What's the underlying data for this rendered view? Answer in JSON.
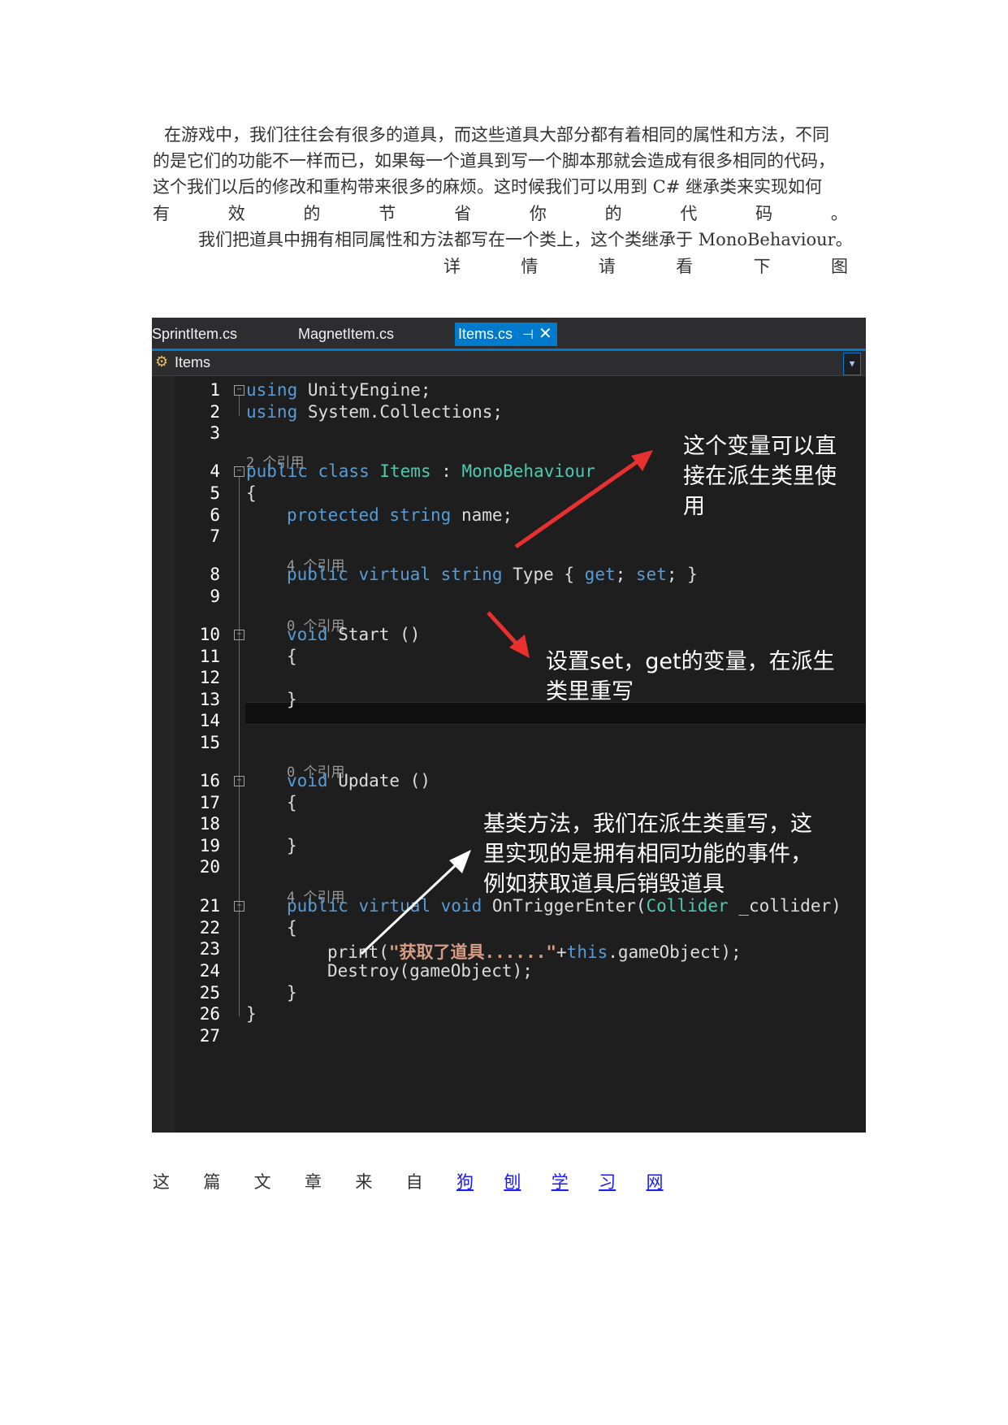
{
  "intro": {
    "line1": "在游戏中，我们往往会有很多的道具，而这些道具大部分都有着相同的属性和方法，不同",
    "line2": "的是它们的功能不一样而已，如果每一个道具到写一个脚本那就会造成有很多相同的代码，",
    "line3": "这个我们以后的修改和重构带来很多的麻烦。这时候我们可以用到 C#  继承类来实现如何",
    "line4": [
      "有",
      "效",
      "的",
      "节",
      "省",
      "你",
      "的",
      "代",
      "码",
      "。"
    ],
    "line5": "我们把道具中拥有相同属性和方法都写在一个类上，这个类继承于 MonoBehaviour。",
    "line6": [
      "详",
      "情",
      "请",
      "看",
      "下",
      "图"
    ]
  },
  "ide": {
    "tabs": [
      "SprintItem.cs",
      "MagnetItem.cs",
      "Items.cs"
    ],
    "tab_pin": "⊣",
    "tab_close": "✕",
    "nav_label": "Items",
    "nav_icon": "class-icon",
    "line_numbers": [
      "1",
      "2",
      "3",
      "4",
      "5",
      "6",
      "7",
      "8",
      "9",
      "10",
      "11",
      "12",
      "13",
      "14",
      "15",
      "16",
      "17",
      "18",
      "19",
      "20",
      "21",
      "22",
      "23",
      "24",
      "25",
      "26",
      "27"
    ],
    "refs": {
      "class": "2 个引用",
      "type": "4 个引用",
      "start": "0 个引用",
      "update": "0 个引用",
      "trigger": "4 个引用"
    },
    "code": {
      "l1_kw": "using",
      "l1_rest": " UnityEngine;",
      "l2_kw": "using",
      "l2_rest": " System.Collections;",
      "l4_kw": "public class",
      "l4_sp1": " ",
      "l4_type": "Items",
      "l4_colon": " : ",
      "l4_base": "MonoBehaviour",
      "l5": "{",
      "l6_kw": "protected string",
      "l6_rest": " name;",
      "l8_kw1": "public virtual string",
      "l8_mid": " Type { ",
      "l8_get": "get",
      "l8_semi": "; ",
      "l8_set": "set",
      "l8_end": "; }",
      "l10_kw": "void",
      "l10_rest": " Start ()",
      "l11": "{",
      "l13": "}",
      "l16_kw": "void",
      "l16_rest": " Update ()",
      "l17": "{",
      "l19": "}",
      "l21_kw": "public virtual void",
      "l21_mid": " OnTriggerEnter(",
      "l21_type": "Collider",
      "l21_end": " _collider)",
      "l22": "{",
      "l23_a": "print(",
      "l23_str": "\"获取了道具......\"",
      "l23_plus": "+",
      "l23_this": "this",
      "l23_end": ".gameObject);",
      "l24": "Destroy(gameObject);",
      "l25": "}",
      "l26": "}"
    },
    "annotations": {
      "a1": [
        "这个变量可以直",
        "接在派生类里使",
        "用"
      ],
      "a2": [
        "设置set，get的变量，在派生",
        "类里重写"
      ],
      "a3": [
        "基类方法，我们在派生类重写，这",
        "里实现的是拥有相同功能的事件，",
        "例如获取道具后销毁道具"
      ]
    },
    "colors": {
      "background": "#1e1e1e",
      "keyword": "#569cd6",
      "type": "#4ec9b0",
      "accent": "#007acc",
      "arrow_red": "#e8312f"
    }
  },
  "source": {
    "prefix": [
      "这",
      "篇",
      "文",
      "章",
      "来",
      "自"
    ],
    "link": [
      "狗",
      "刨",
      "学",
      "习",
      "网"
    ]
  }
}
